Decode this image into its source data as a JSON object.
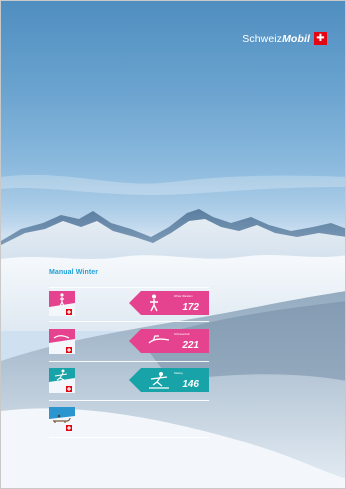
{
  "brand": {
    "name_regular": "Schweiz",
    "name_bold": "Mobil",
    "flag_symbol": "✚",
    "flag_color": "#e30613"
  },
  "manual": {
    "title": "Manual Winter",
    "title_color": "#1fa0d8"
  },
  "rows": [
    {
      "icon": "snowshoe-hiker-icon",
      "color": "#e5428f",
      "route_number": "172",
      "caption": "Winter Wandern"
    },
    {
      "icon": "sledge-icon",
      "color": "#e5428f",
      "route_number": "221",
      "caption": "Schneeschuh"
    },
    {
      "icon": "cross-country-ski-icon",
      "color": "#17a3a8",
      "route_number": "146",
      "caption": "Skating"
    },
    {
      "icon": "toboggan-icon",
      "color": "#7a9db8",
      "route_number": "",
      "caption": ""
    }
  ]
}
